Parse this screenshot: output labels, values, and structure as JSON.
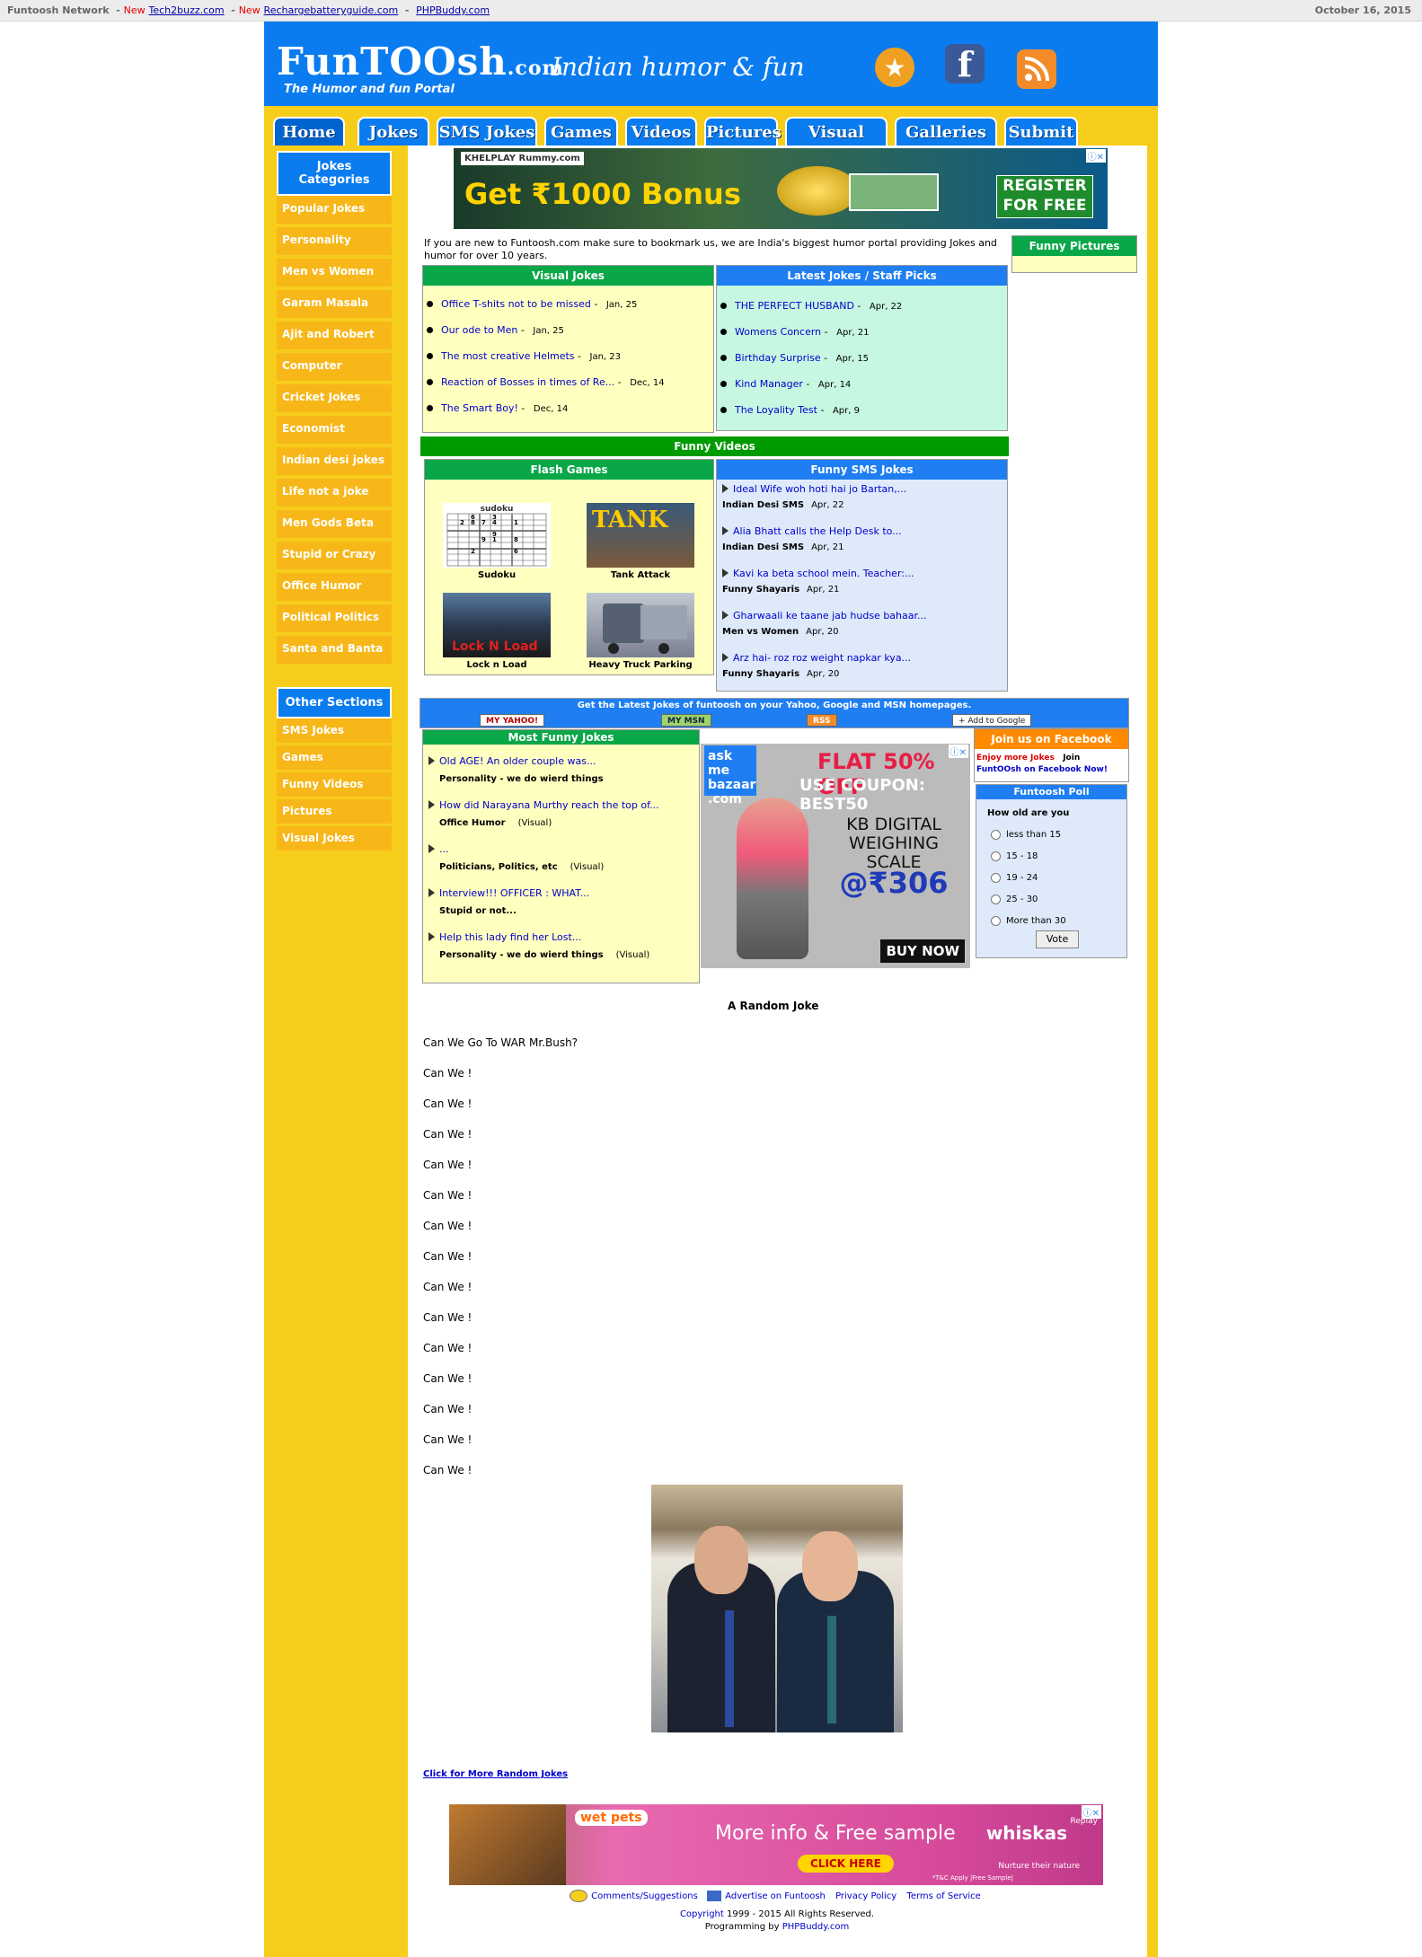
{
  "topbar": {
    "network_label": "Funtoosh Network",
    "links": [
      {
        "new": "New",
        "label": "Tech2buzz.com"
      },
      {
        "new": "New",
        "label": "Rechargebatteryguide.com"
      },
      {
        "new": "",
        "label": "PHPBuddy.com"
      }
    ],
    "date": "October 16, 2015"
  },
  "header": {
    "logo": "FunTOOsh",
    "logo_suffix": ".com",
    "tagline": "The Humor and fun Portal",
    "headline": "Indian humor & fun",
    "icons": [
      "favorite-icon",
      "facebook-icon",
      "rss-icon"
    ]
  },
  "nav": [
    "Home",
    "Jokes",
    "SMS Jokes",
    "Games",
    "Videos",
    "Pictures",
    "Visual Joke",
    "Galleries",
    "Submit"
  ],
  "sidebar": {
    "categories_title": "Jokes Categories",
    "categories": [
      "Popular Jokes",
      "Personality",
      "Men vs Women",
      "Garam Masala",
      "Ajit and Robert",
      "Computer",
      "Cricket Jokes",
      "Economist",
      "Indian desi jokes",
      "Life not a joke",
      "Men Gods Beta",
      "Stupid or Crazy",
      "Office Humor",
      "Political Politics",
      "Santa and Banta"
    ],
    "other_title": "Other Sections",
    "other": [
      "SMS Jokes",
      "Games",
      "Funny Videos",
      "Pictures",
      "Visual Jokes"
    ]
  },
  "ads": {
    "top": {
      "brand": "KHELPLAY Rummy.com",
      "headline": "Get ₹1000 Bonus",
      "cta": "REGISTER FOR FREE"
    },
    "middle": {
      "brand": "ask me bazaar .com",
      "flat": "FLAT 50% OFF",
      "coupon": "USE COUPON: BEST50",
      "product": "KB DIGITAL WEIGHING SCALE",
      "price": "@₹306",
      "cta": "BUY NOW"
    },
    "bottom": {
      "brand": "wet pets",
      "message": "More info & Free sample",
      "cta": "CLICK HERE",
      "product": "whiskas",
      "slogan": "Nurture their nature",
      "tc": "*T&C Apply |Free Sample|",
      "replay": "Replay"
    }
  },
  "intro": "If you are new to Funtoosh.com make sure to bookmark us, we are India's biggest humor portal providing Jokes and humor for over 10 years.",
  "visual_jokes": {
    "title": "Visual Jokes",
    "items": [
      {
        "title": "Office T-shits not to be missed",
        "date": "Jan, 25"
      },
      {
        "title": "Our ode to Men",
        "date": "Jan, 25"
      },
      {
        "title": "The most creative Helmets",
        "date": "Jan, 23"
      },
      {
        "title": "Reaction of Bosses in times of Re...",
        "date": "Dec, 14"
      },
      {
        "title": "The Smart Boy!",
        "date": "Dec, 14"
      }
    ]
  },
  "latest_jokes": {
    "title": "Latest Jokes / Staff Picks",
    "items": [
      {
        "title": "THE PERFECT HUSBAND",
        "date": "Apr, 22"
      },
      {
        "title": "Womens Concern",
        "date": "Apr, 21"
      },
      {
        "title": "Birthday Surprise",
        "date": "Apr, 15"
      },
      {
        "title": "Kind Manager",
        "date": "Apr, 14"
      },
      {
        "title": "The Loyality Test",
        "date": "Apr, 9"
      }
    ]
  },
  "funny_pictures": {
    "title": "Funny Pictures"
  },
  "funny_videos": {
    "title": "Funny Videos"
  },
  "flash_games": {
    "title": "Flash Games",
    "items": [
      {
        "label": "Sudoku",
        "thumb_text": "sudoku"
      },
      {
        "label": "Tank Attack",
        "thumb_text": "TANK"
      },
      {
        "label": "Lock n Load",
        "thumb_text": "Lock N Load"
      },
      {
        "label": "Heavy Truck Parking",
        "thumb_text": ""
      }
    ]
  },
  "sms_jokes": {
    "title": "Funny SMS Jokes",
    "items": [
      {
        "title": "Ideal Wife woh hoti hai jo Bartan,...",
        "category": "Indian Desi SMS",
        "date": "Apr, 22"
      },
      {
        "title": "Alia Bhatt calls the Help Desk to...",
        "category": "Indian Desi SMS",
        "date": "Apr, 21"
      },
      {
        "title": "Kavi ka beta school mein. Teacher:...",
        "category": "Funny Shayaris",
        "date": "Apr, 21"
      },
      {
        "title": "Gharwaali ke taane jab hudse bahaar...",
        "category": "Men vs Women",
        "date": "Apr, 20"
      },
      {
        "title": "Arz hai- roz roz weight napkar kya...",
        "category": "Funny Shayaris",
        "date": "Apr, 20"
      }
    ]
  },
  "latest_bar": {
    "text": "Get the Latest Jokes of funtoosh on your Yahoo, Google and MSN homepages.",
    "yahoo": "MY YAHOO!",
    "msn": "MY MSN",
    "rss": "RSS",
    "google": "+ Add to Google"
  },
  "most_funny": {
    "title": "Most Funny Jokes",
    "items": [
      {
        "title": "Old AGE! An older couple was...",
        "category": "Personality - we do wierd things",
        "tag": ""
      },
      {
        "title": "How did Narayana Murthy reach the top of...",
        "category": "Office Humor",
        "tag": "(Visual)"
      },
      {
        "title": "...",
        "category": "Politicians, Politics, etc",
        "tag": "(Visual)"
      },
      {
        "title": "Interview!!! OFFICER : WHAT...",
        "category": "Stupid or not...",
        "tag": ""
      },
      {
        "title": "Help this lady find her Lost...",
        "category": "Personality - we do wierd things",
        "tag": "(Visual)"
      }
    ]
  },
  "facebook_box": {
    "title": "Join us on Facebook",
    "enjoy": "Enjoy more Jokes",
    "join": "Join",
    "link": "FuntOOsh on Facebook Now!"
  },
  "poll": {
    "title": "Funtoosh Poll",
    "question": "How old are you",
    "options": [
      "less than 15",
      "15 - 18",
      "19 - 24",
      "25 - 30",
      "More than 30"
    ],
    "vote": "Vote"
  },
  "random_joke": {
    "title": "A Random Joke",
    "lines": [
      "Can We Go To WAR Mr.Bush?",
      "Can We !",
      "Can We !",
      "Can We !",
      "Can We !",
      "Can We !",
      "Can We !",
      "Can We !",
      "Can We !",
      "Can We !",
      "Can We !",
      "Can We !",
      "Can We !",
      "Can We !",
      "Can We !"
    ],
    "more_link": "Click for More Random Jokes"
  },
  "footer": {
    "links": [
      "Comments/Suggestions",
      "Advertise on Funtoosh",
      "Privacy Policy",
      "Terms of Service"
    ],
    "copyright_word": "Copyright",
    "copyright_rest": "1999 - 2015 All Rights Reserved.",
    "programming": "Programming by",
    "programming_link": "PHPBuddy.com"
  },
  "colors": {
    "header_blue": "#0a7cef",
    "sidebar_yellow": "#f7cd1b",
    "green": "#09a748",
    "orange": "#ff8a00"
  }
}
